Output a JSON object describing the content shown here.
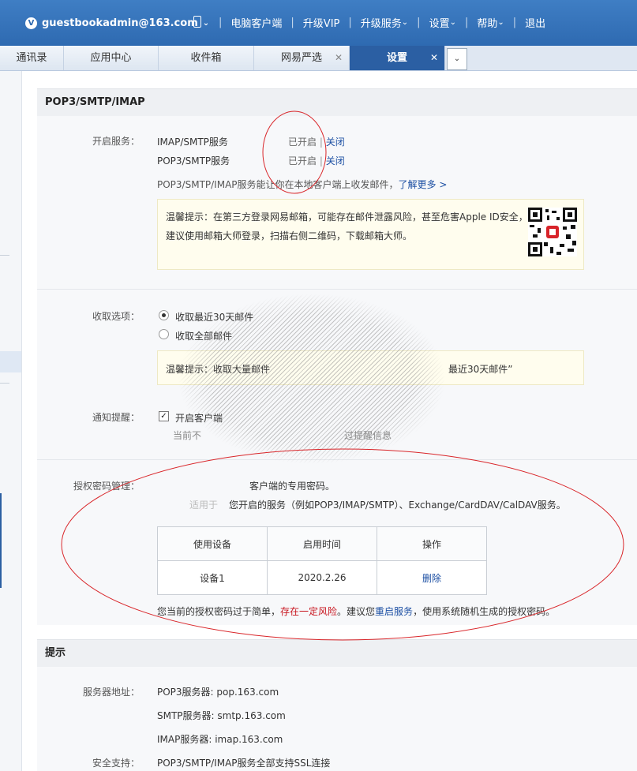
{
  "topbar": {
    "account": "guestbookadmin@163.com",
    "vip_icon": "V",
    "links": [
      "电脑客户端",
      "升级VIP",
      "升级服务",
      "设置",
      "帮助",
      "退出"
    ],
    "dropdown_links": [
      2,
      3,
      4
    ]
  },
  "tabs": [
    {
      "label": "通讯录",
      "closable": false,
      "active": false
    },
    {
      "label": "应用中心",
      "closable": false,
      "active": false
    },
    {
      "label": "收件箱",
      "closable": false,
      "active": false
    },
    {
      "label": "网易严选",
      "closable": true,
      "active": false
    },
    {
      "label": "设置",
      "closable": true,
      "active": true
    }
  ],
  "section1": {
    "title": "POP3/SMTP/IMAP",
    "service_label": "开启服务：",
    "services": [
      {
        "name": "IMAP/SMTP服务",
        "status": "已开启",
        "sep": "|",
        "action": "关闭"
      },
      {
        "name": "POP3/SMTP服务",
        "status": "已开启",
        "sep": "|",
        "action": "关闭"
      }
    ],
    "desc": "POP3/SMTP/IMAP服务能让你在本地客户端上收发邮件，",
    "learn_more": "了解更多 >",
    "tip1": "温馨提示：在第三方登录网易邮箱，可能存在邮件泄露风险，甚至危害Apple ID安全，建议使用邮箱大师登录，扫描右侧二维码，下载邮箱大师。",
    "fetch_label": "收取选项：",
    "fetch_options": [
      "收取最近30天邮件",
      "收取全部邮件"
    ],
    "tip2_left": "温馨提示：收取大量邮件",
    "tip2_right": "最近30天邮件”",
    "notify_label": "通知提醒：",
    "notify_option": "开启客户端",
    "notify_sub_left": "当前不",
    "notify_sub_right": "过提醒信息",
    "auth_label": "授权密码管理：",
    "auth_line1": "客户端的专用密码。",
    "auth_line2_a": "适用于",
    "auth_line2_b": "您开启的服务（例如POP3/IMAP/SMTP）、Exchange/CardDAV/CalDAV服务。",
    "table_headers": [
      "使用设备",
      "启用时间",
      "操作"
    ],
    "table_rows": [
      {
        "device": "设备1",
        "time": "2020.2.26",
        "action": "删除"
      }
    ],
    "warn_a": "您当前的授权密码过于简单，",
    "warn_risk": "存在一定风险",
    "warn_b": "。建议您",
    "warn_restart": "重启服务",
    "warn_c": "，使用系统随机生成的授权密码。"
  },
  "section2": {
    "title": "提示",
    "server_label": "服务器地址：",
    "servers": [
      "POP3服务器: pop.163.com",
      "SMTP服务器: smtp.163.com",
      "IMAP服务器: imap.163.com"
    ],
    "security_label": "安全支持：",
    "security_text": "POP3/SMTP/IMAP服务全部支持SSL连接"
  },
  "colors": {
    "topbar": "#3572bb",
    "link": "#1c4fa3",
    "risk": "#c8141e",
    "annotation": "#d9262a"
  }
}
